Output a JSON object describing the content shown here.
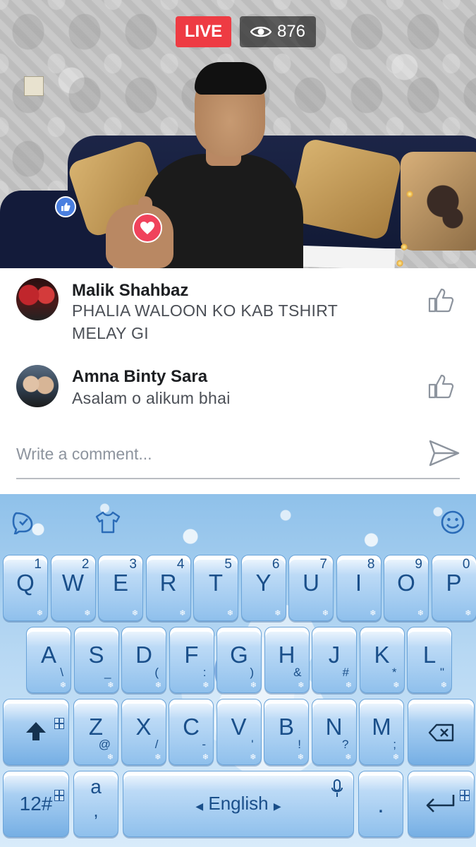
{
  "live_video": {
    "live_label": "LIVE",
    "viewer_count": "876"
  },
  "comments": [
    {
      "author": "Malik Shahbaz",
      "text_line1": "PHALIA WALOON KO KAB TSHIRT",
      "text_line2": "MELAY GI"
    },
    {
      "author": "Amna Binty Sara",
      "text_line1": "Asalam o alikum bhai"
    }
  ],
  "comment_input": {
    "placeholder": "Write a comment..."
  },
  "keyboard": {
    "row1": [
      {
        "key": "Q",
        "num": "1"
      },
      {
        "key": "W",
        "num": "2"
      },
      {
        "key": "E",
        "num": "3"
      },
      {
        "key": "R",
        "num": "4"
      },
      {
        "key": "T",
        "num": "5"
      },
      {
        "key": "Y",
        "num": "6"
      },
      {
        "key": "U",
        "num": "7"
      },
      {
        "key": "I",
        "num": "8"
      },
      {
        "key": "O",
        "num": "9"
      },
      {
        "key": "P",
        "num": "0"
      }
    ],
    "row2": [
      {
        "key": "A",
        "alt": "\\"
      },
      {
        "key": "S",
        "alt": "_"
      },
      {
        "key": "D",
        "alt": "("
      },
      {
        "key": "F",
        "alt": ":"
      },
      {
        "key": "G",
        "alt": ")"
      },
      {
        "key": "H",
        "alt": "&"
      },
      {
        "key": "J",
        "alt": "#"
      },
      {
        "key": "K",
        "alt": "*"
      },
      {
        "key": "L",
        "alt": "\""
      }
    ],
    "row3": [
      {
        "key": "Z",
        "alt": "@"
      },
      {
        "key": "X",
        "alt": "/"
      },
      {
        "key": "C",
        "alt": "-"
      },
      {
        "key": "V",
        "alt": "'"
      },
      {
        "key": "B",
        "alt": "!"
      },
      {
        "key": "N",
        "alt": "?"
      },
      {
        "key": "M",
        "alt": ";"
      }
    ],
    "symbols_label": "12#",
    "comma_key": {
      "main": "a",
      "alt": ","
    },
    "space_label": "English",
    "period_label": "."
  }
}
